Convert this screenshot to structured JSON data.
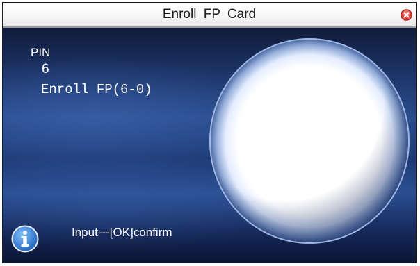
{
  "window": {
    "title": "Enroll FP Card",
    "close_icon": "close-icon"
  },
  "form": {
    "pin_label": "PIN",
    "pin_value": "6",
    "enroll_status": "Enroll FP(6-0)"
  },
  "footer": {
    "info_icon": "info-icon",
    "hint": "Input---[OK]confirm"
  },
  "fingerprint_area": {
    "icon": "fingerprint-placeholder-circle"
  },
  "colors": {
    "background": "#1e3a74",
    "title_bar": "#f6f6f6",
    "close_button": "#e0433a",
    "info_icon": "#2f78d6",
    "text": "#ffffff"
  }
}
